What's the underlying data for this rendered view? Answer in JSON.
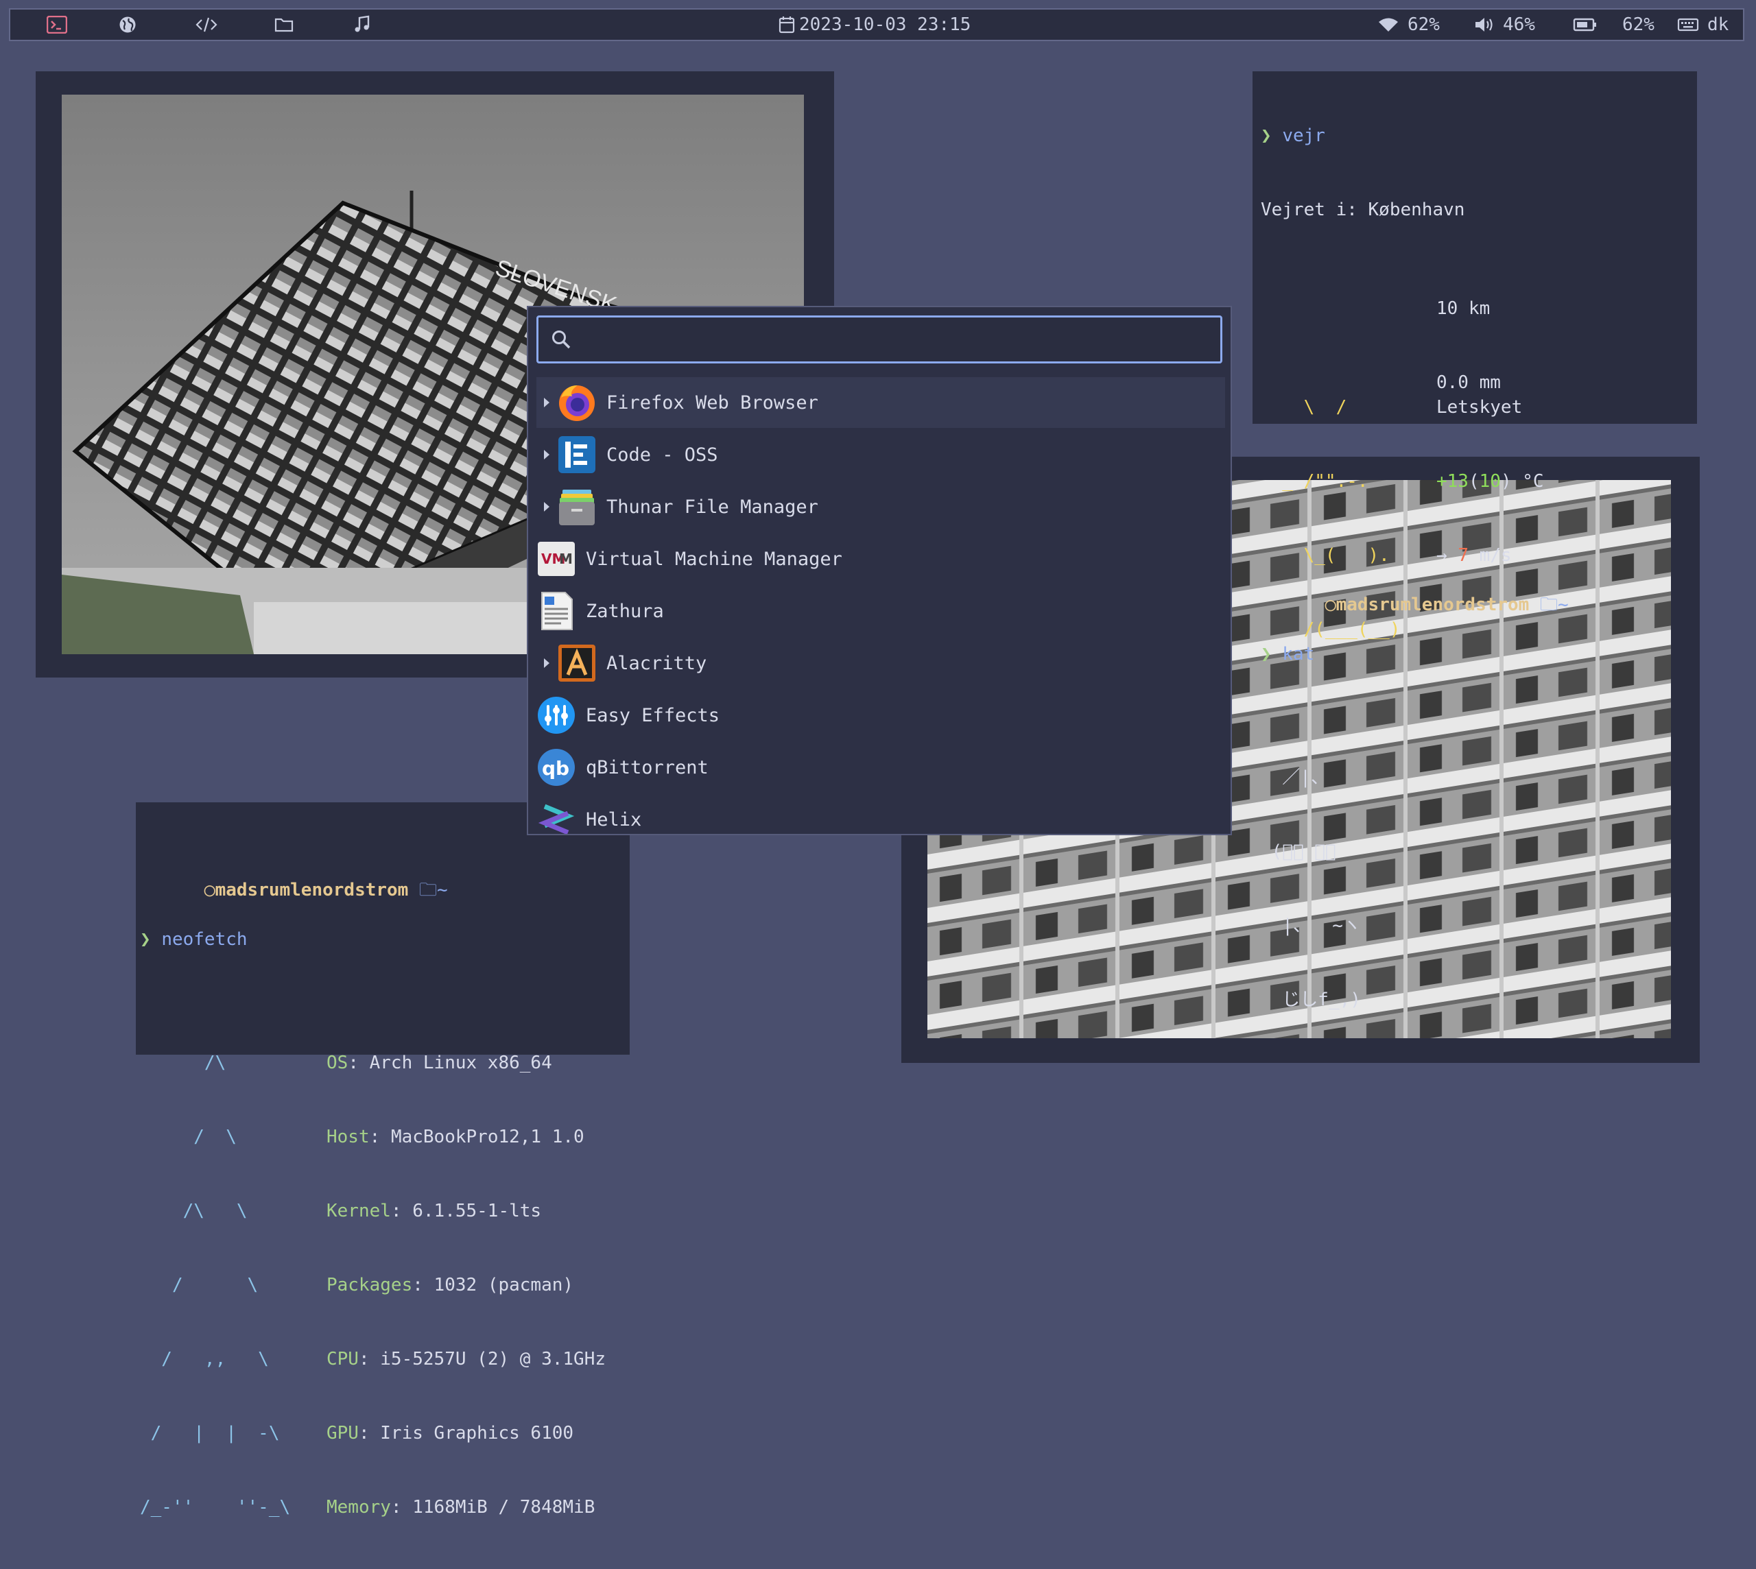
{
  "topbar": {
    "workspaces": [
      {
        "icon": "terminal-icon"
      },
      {
        "icon": "globe-icon"
      },
      {
        "icon": "code-icon"
      },
      {
        "icon": "folder-icon"
      },
      {
        "icon": "music-note-icon"
      }
    ],
    "clock": "2023-10-03 23:15",
    "wifi": "62%",
    "volume": "46%",
    "battery": "62%",
    "keyboard_layout": "dk"
  },
  "weather_terminal": {
    "prompt_symbol": "❯",
    "command": "vejr",
    "heading": "Vejret i: København",
    "art": [
      "    \\  /",
      "  _ /\"\".-.",
      "    \\_(   ).",
      "    /(___(__)"
    ],
    "condition": "Letskyet",
    "temp_main": "+13",
    "temp_feels": "10",
    "temp_unit": ") °C",
    "wind_arrow": "→",
    "wind_speed": "7",
    "wind_unit": "m/s",
    "visibility": "10 km",
    "precipitation": "0.0 mm",
    "user": "madsrumlenordstrom",
    "dir": "~",
    "command2": "kat",
    "cat_art": [
      "  ／|、",
      " (ﾟ､ ｡７",
      "  |、  ~ヽ",
      "  じしf_,)"
    ]
  },
  "neofetch_terminal": {
    "user": "madsrumlenordstrom",
    "dir": "~",
    "prompt_symbol": "❯",
    "command": "neofetch",
    "logo": [
      "      /\\",
      "     /  \\",
      "    /\\   \\",
      "   /      \\",
      "  /   ,,   \\",
      " /   |  |  -\\",
      "/_-''    ''-_\\"
    ],
    "info": [
      {
        "key": "OS",
        "value": "Arch Linux x86_64"
      },
      {
        "key": "Host",
        "value": "MacBookPro12,1 1.0"
      },
      {
        "key": "Kernel",
        "value": "6.1.55-1-lts"
      },
      {
        "key": "Packages",
        "value": "1032 (pacman)"
      },
      {
        "key": "CPU",
        "value": "i5-5257U (2) @ 3.1GHz"
      },
      {
        "key": "GPU",
        "value": "Iris Graphics 6100"
      },
      {
        "key": "Memory",
        "value": "1168MiB / 7848MiB"
      }
    ]
  },
  "photo_left": {
    "sign_text": "SLOVENSK"
  },
  "launcher": {
    "search_value": "",
    "search_placeholder": "",
    "apps": [
      {
        "label": "Firefox Web Browser",
        "icon": "firefox-icon",
        "expandable": true,
        "selected": true
      },
      {
        "label": "Code - OSS",
        "icon": "code-oss-icon",
        "expandable": true,
        "selected": false
      },
      {
        "label": "Thunar File Manager",
        "icon": "thunar-icon",
        "expandable": true,
        "selected": false
      },
      {
        "label": "Virtual Machine Manager",
        "icon": "virt-manager-icon",
        "expandable": false,
        "selected": false
      },
      {
        "label": "Zathura",
        "icon": "zathura-icon",
        "expandable": false,
        "selected": false
      },
      {
        "label": "Alacritty",
        "icon": "alacritty-icon",
        "expandable": true,
        "selected": false
      },
      {
        "label": "Easy Effects",
        "icon": "easy-effects-icon",
        "expandable": false,
        "selected": false
      },
      {
        "label": "qBittorrent",
        "icon": "qbittorrent-icon",
        "expandable": false,
        "selected": false
      },
      {
        "label": "Helix",
        "icon": "helix-icon",
        "expandable": false,
        "selected": false
      }
    ]
  },
  "colors": {
    "desktop_bg": "#4a4f6e",
    "panel_bg": "#2a2d40",
    "accent": "#8caaee",
    "prompt_green": "#a6d189",
    "user_yellow": "#e5c890"
  }
}
